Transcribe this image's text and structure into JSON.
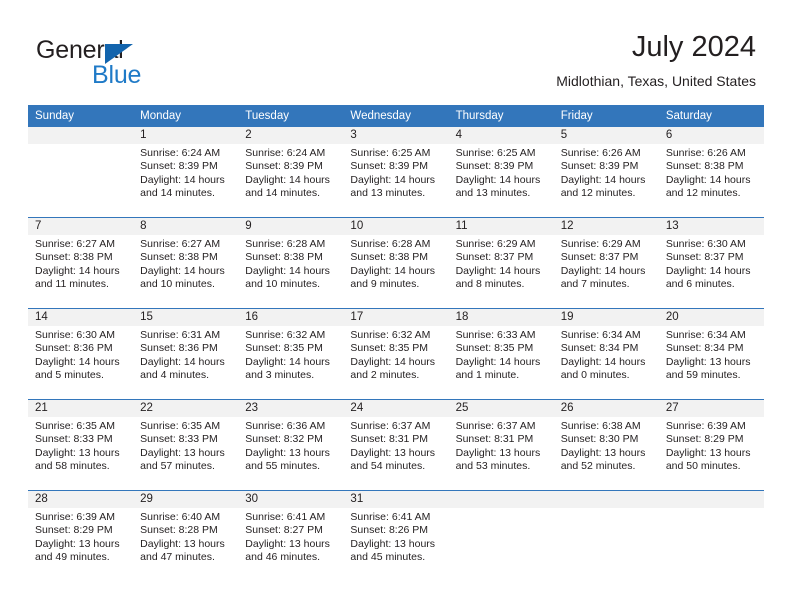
{
  "brand": {
    "name_dark": "General",
    "name_blue": "Blue",
    "accent_color": "#1f7ac7",
    "triangle_color": "#1264ad"
  },
  "header": {
    "month_title": "July 2024",
    "location": "Midlothian, Texas, United States",
    "header_bg": "#3376bb",
    "daynum_band_bg": "#f2f2f2"
  },
  "weekday_headers": [
    "Sunday",
    "Monday",
    "Tuesday",
    "Wednesday",
    "Thursday",
    "Friday",
    "Saturday"
  ],
  "weeks": [
    [
      {
        "day": "",
        "sunrise": "",
        "sunset": "",
        "daylight_line1": "",
        "daylight_line2": ""
      },
      {
        "day": "1",
        "sunrise": "Sunrise: 6:24 AM",
        "sunset": "Sunset: 8:39 PM",
        "daylight_line1": "Daylight: 14 hours",
        "daylight_line2": "and 14 minutes."
      },
      {
        "day": "2",
        "sunrise": "Sunrise: 6:24 AM",
        "sunset": "Sunset: 8:39 PM",
        "daylight_line1": "Daylight: 14 hours",
        "daylight_line2": "and 14 minutes."
      },
      {
        "day": "3",
        "sunrise": "Sunrise: 6:25 AM",
        "sunset": "Sunset: 8:39 PM",
        "daylight_line1": "Daylight: 14 hours",
        "daylight_line2": "and 13 minutes."
      },
      {
        "day": "4",
        "sunrise": "Sunrise: 6:25 AM",
        "sunset": "Sunset: 8:39 PM",
        "daylight_line1": "Daylight: 14 hours",
        "daylight_line2": "and 13 minutes."
      },
      {
        "day": "5",
        "sunrise": "Sunrise: 6:26 AM",
        "sunset": "Sunset: 8:39 PM",
        "daylight_line1": "Daylight: 14 hours",
        "daylight_line2": "and 12 minutes."
      },
      {
        "day": "6",
        "sunrise": "Sunrise: 6:26 AM",
        "sunset": "Sunset: 8:38 PM",
        "daylight_line1": "Daylight: 14 hours",
        "daylight_line2": "and 12 minutes."
      }
    ],
    [
      {
        "day": "7",
        "sunrise": "Sunrise: 6:27 AM",
        "sunset": "Sunset: 8:38 PM",
        "daylight_line1": "Daylight: 14 hours",
        "daylight_line2": "and 11 minutes."
      },
      {
        "day": "8",
        "sunrise": "Sunrise: 6:27 AM",
        "sunset": "Sunset: 8:38 PM",
        "daylight_line1": "Daylight: 14 hours",
        "daylight_line2": "and 10 minutes."
      },
      {
        "day": "9",
        "sunrise": "Sunrise: 6:28 AM",
        "sunset": "Sunset: 8:38 PM",
        "daylight_line1": "Daylight: 14 hours",
        "daylight_line2": "and 10 minutes."
      },
      {
        "day": "10",
        "sunrise": "Sunrise: 6:28 AM",
        "sunset": "Sunset: 8:38 PM",
        "daylight_line1": "Daylight: 14 hours",
        "daylight_line2": "and 9 minutes."
      },
      {
        "day": "11",
        "sunrise": "Sunrise: 6:29 AM",
        "sunset": "Sunset: 8:37 PM",
        "daylight_line1": "Daylight: 14 hours",
        "daylight_line2": "and 8 minutes."
      },
      {
        "day": "12",
        "sunrise": "Sunrise: 6:29 AM",
        "sunset": "Sunset: 8:37 PM",
        "daylight_line1": "Daylight: 14 hours",
        "daylight_line2": "and 7 minutes."
      },
      {
        "day": "13",
        "sunrise": "Sunrise: 6:30 AM",
        "sunset": "Sunset: 8:37 PM",
        "daylight_line1": "Daylight: 14 hours",
        "daylight_line2": "and 6 minutes."
      }
    ],
    [
      {
        "day": "14",
        "sunrise": "Sunrise: 6:30 AM",
        "sunset": "Sunset: 8:36 PM",
        "daylight_line1": "Daylight: 14 hours",
        "daylight_line2": "and 5 minutes."
      },
      {
        "day": "15",
        "sunrise": "Sunrise: 6:31 AM",
        "sunset": "Sunset: 8:36 PM",
        "daylight_line1": "Daylight: 14 hours",
        "daylight_line2": "and 4 minutes."
      },
      {
        "day": "16",
        "sunrise": "Sunrise: 6:32 AM",
        "sunset": "Sunset: 8:35 PM",
        "daylight_line1": "Daylight: 14 hours",
        "daylight_line2": "and 3 minutes."
      },
      {
        "day": "17",
        "sunrise": "Sunrise: 6:32 AM",
        "sunset": "Sunset: 8:35 PM",
        "daylight_line1": "Daylight: 14 hours",
        "daylight_line2": "and 2 minutes."
      },
      {
        "day": "18",
        "sunrise": "Sunrise: 6:33 AM",
        "sunset": "Sunset: 8:35 PM",
        "daylight_line1": "Daylight: 14 hours",
        "daylight_line2": "and 1 minute."
      },
      {
        "day": "19",
        "sunrise": "Sunrise: 6:34 AM",
        "sunset": "Sunset: 8:34 PM",
        "daylight_line1": "Daylight: 14 hours",
        "daylight_line2": "and 0 minutes."
      },
      {
        "day": "20",
        "sunrise": "Sunrise: 6:34 AM",
        "sunset": "Sunset: 8:34 PM",
        "daylight_line1": "Daylight: 13 hours",
        "daylight_line2": "and 59 minutes."
      }
    ],
    [
      {
        "day": "21",
        "sunrise": "Sunrise: 6:35 AM",
        "sunset": "Sunset: 8:33 PM",
        "daylight_line1": "Daylight: 13 hours",
        "daylight_line2": "and 58 minutes."
      },
      {
        "day": "22",
        "sunrise": "Sunrise: 6:35 AM",
        "sunset": "Sunset: 8:33 PM",
        "daylight_line1": "Daylight: 13 hours",
        "daylight_line2": "and 57 minutes."
      },
      {
        "day": "23",
        "sunrise": "Sunrise: 6:36 AM",
        "sunset": "Sunset: 8:32 PM",
        "daylight_line1": "Daylight: 13 hours",
        "daylight_line2": "and 55 minutes."
      },
      {
        "day": "24",
        "sunrise": "Sunrise: 6:37 AM",
        "sunset": "Sunset: 8:31 PM",
        "daylight_line1": "Daylight: 13 hours",
        "daylight_line2": "and 54 minutes."
      },
      {
        "day": "25",
        "sunrise": "Sunrise: 6:37 AM",
        "sunset": "Sunset: 8:31 PM",
        "daylight_line1": "Daylight: 13 hours",
        "daylight_line2": "and 53 minutes."
      },
      {
        "day": "26",
        "sunrise": "Sunrise: 6:38 AM",
        "sunset": "Sunset: 8:30 PM",
        "daylight_line1": "Daylight: 13 hours",
        "daylight_line2": "and 52 minutes."
      },
      {
        "day": "27",
        "sunrise": "Sunrise: 6:39 AM",
        "sunset": "Sunset: 8:29 PM",
        "daylight_line1": "Daylight: 13 hours",
        "daylight_line2": "and 50 minutes."
      }
    ],
    [
      {
        "day": "28",
        "sunrise": "Sunrise: 6:39 AM",
        "sunset": "Sunset: 8:29 PM",
        "daylight_line1": "Daylight: 13 hours",
        "daylight_line2": "and 49 minutes."
      },
      {
        "day": "29",
        "sunrise": "Sunrise: 6:40 AM",
        "sunset": "Sunset: 8:28 PM",
        "daylight_line1": "Daylight: 13 hours",
        "daylight_line2": "and 47 minutes."
      },
      {
        "day": "30",
        "sunrise": "Sunrise: 6:41 AM",
        "sunset": "Sunset: 8:27 PM",
        "daylight_line1": "Daylight: 13 hours",
        "daylight_line2": "and 46 minutes."
      },
      {
        "day": "31",
        "sunrise": "Sunrise: 6:41 AM",
        "sunset": "Sunset: 8:26 PM",
        "daylight_line1": "Daylight: 13 hours",
        "daylight_line2": "and 45 minutes."
      },
      {
        "day": "",
        "sunrise": "",
        "sunset": "",
        "daylight_line1": "",
        "daylight_line2": ""
      },
      {
        "day": "",
        "sunrise": "",
        "sunset": "",
        "daylight_line1": "",
        "daylight_line2": ""
      },
      {
        "day": "",
        "sunrise": "",
        "sunset": "",
        "daylight_line1": "",
        "daylight_line2": ""
      }
    ]
  ]
}
